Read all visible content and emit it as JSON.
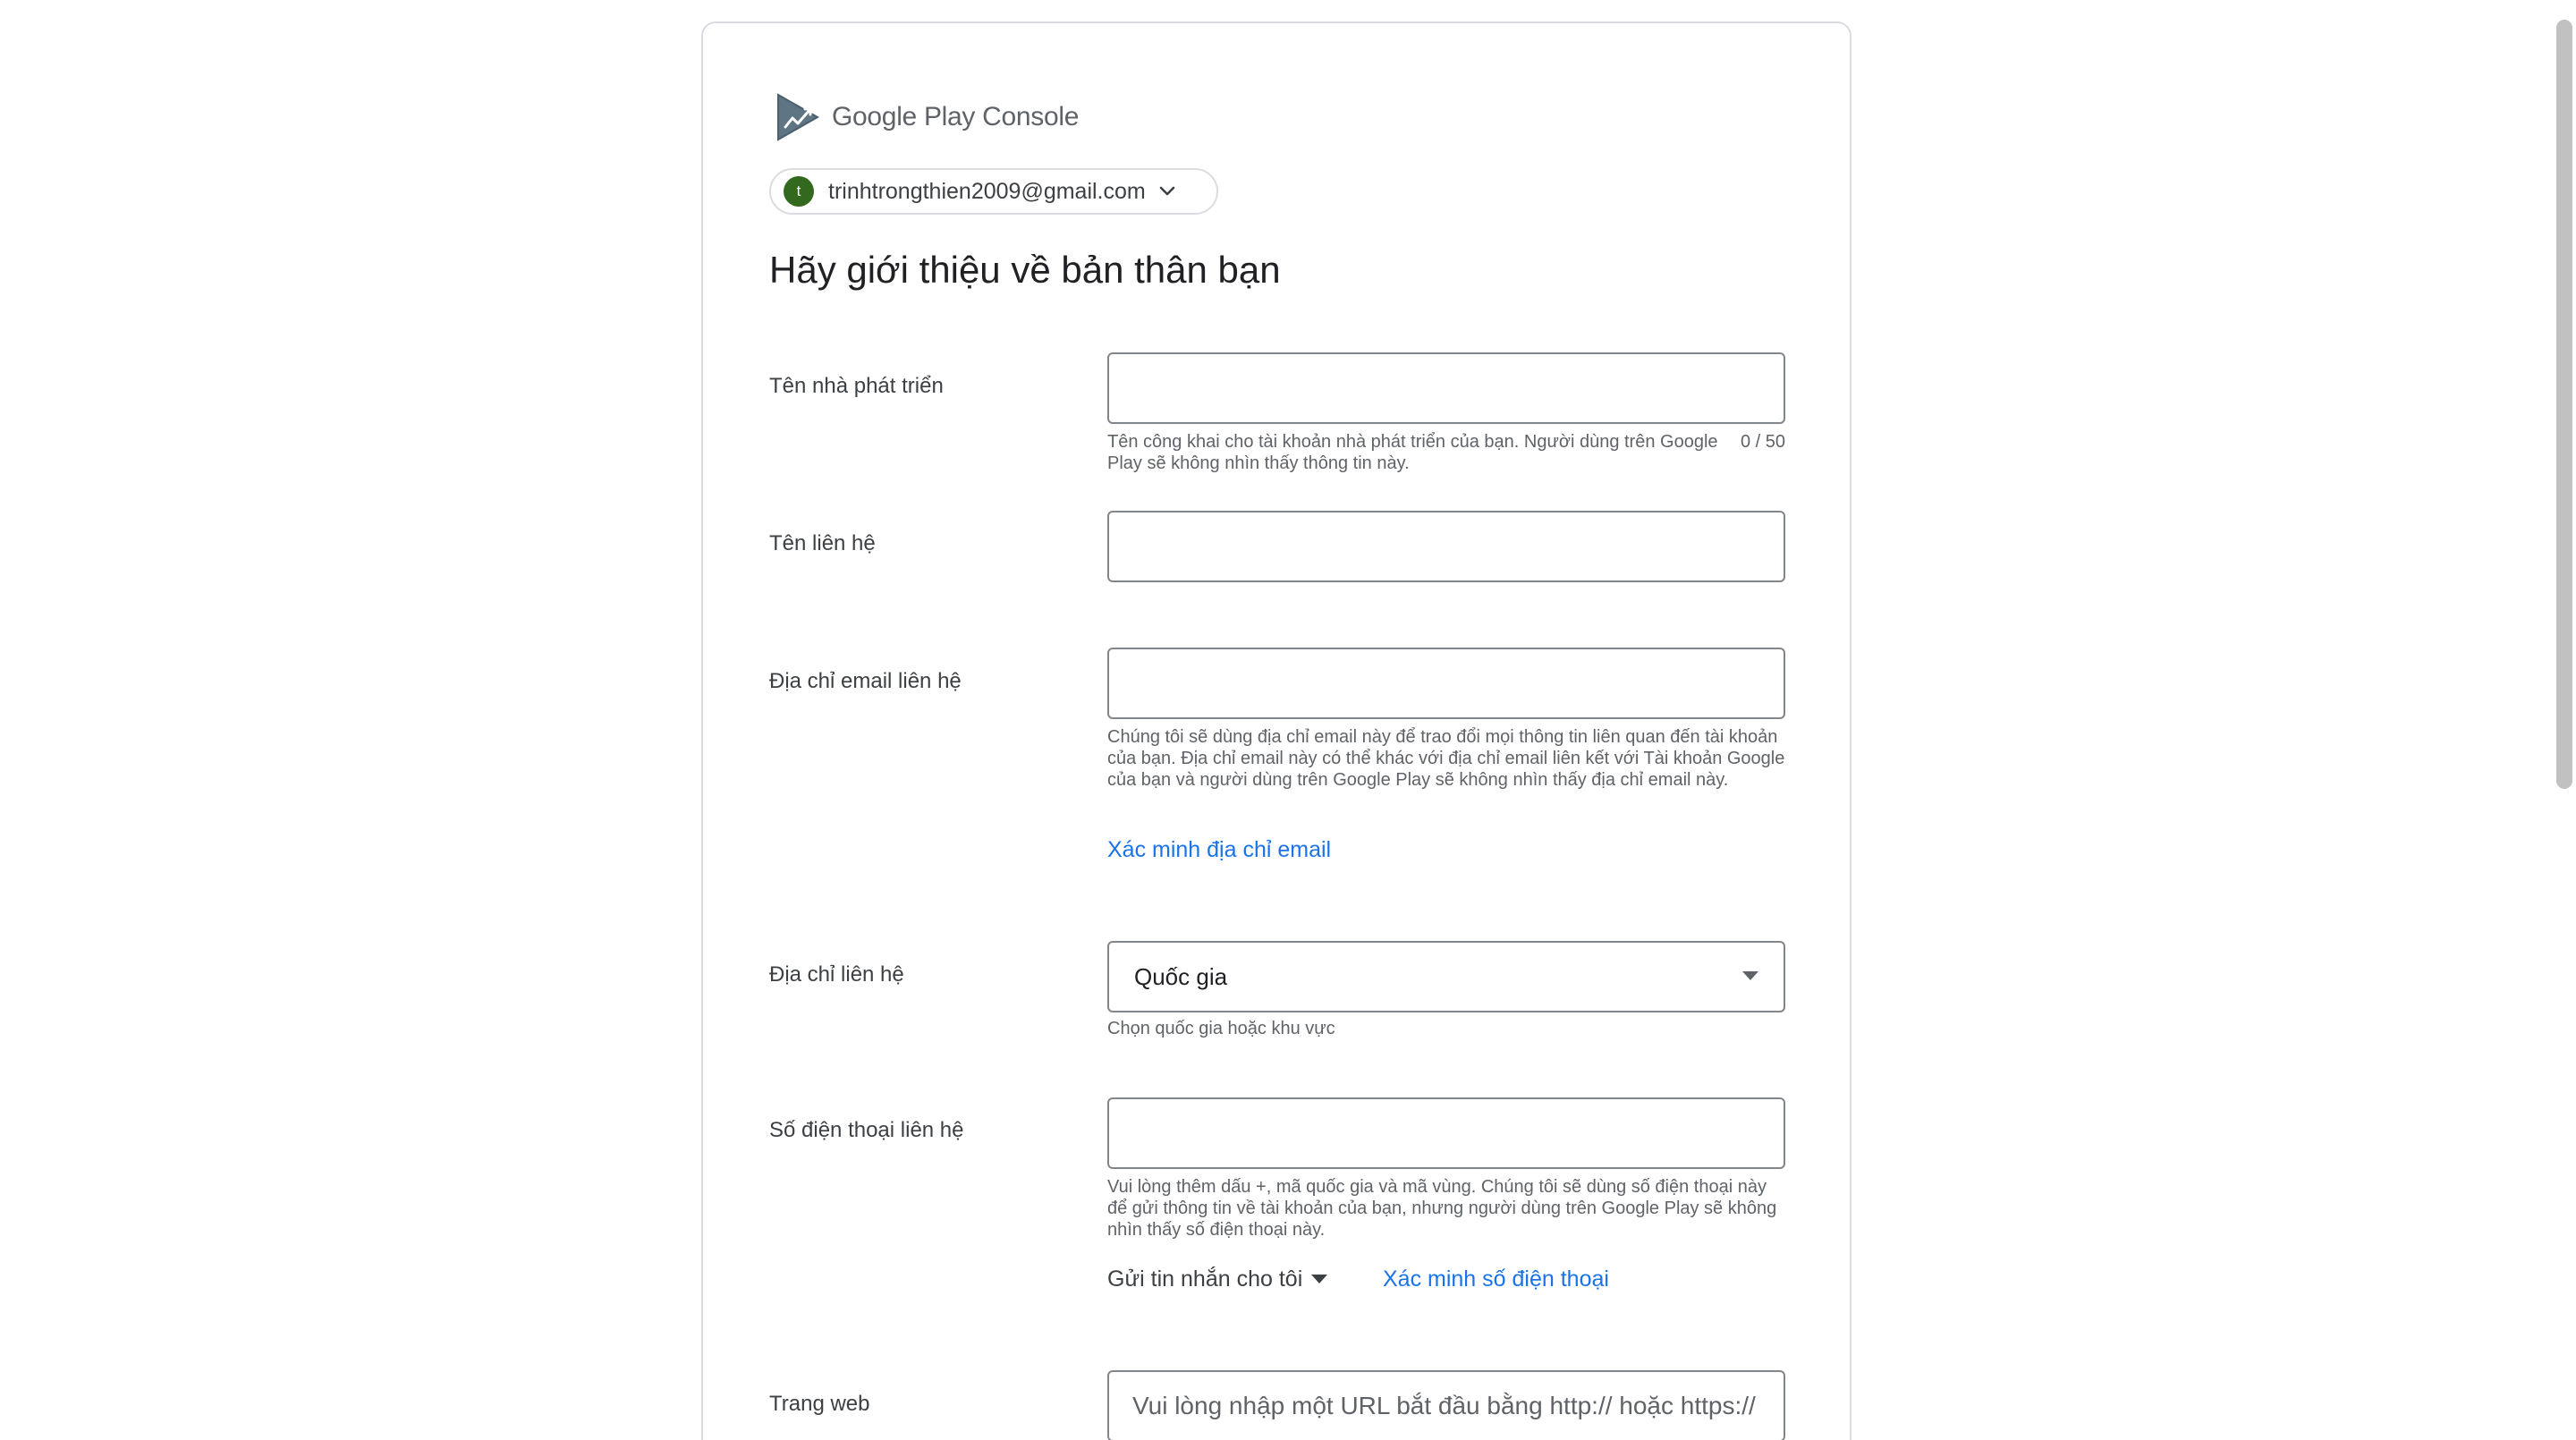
{
  "header": {
    "logo_brand": "Google Play",
    "logo_product": "Console",
    "logo_icon": "play-console-icon"
  },
  "account": {
    "avatar_initial": "t",
    "email": "trinhtrongthien2009@gmail.com",
    "avatar_color": "#33691e"
  },
  "form": {
    "title": "Hãy giới thiệu về bản thân bạn",
    "developer_name": {
      "label": "Tên nhà phát triển",
      "value": "",
      "helper": "Tên công khai cho tài khoản nhà phát triển của bạn. Người dùng trên Google Play sẽ không nhìn thấy thông tin này.",
      "counter": "0 / 50"
    },
    "contact_name": {
      "label": "Tên liên hệ",
      "value": ""
    },
    "contact_email": {
      "label": "Địa chỉ email liên hệ",
      "value": "",
      "helper": "Chúng tôi sẽ dùng địa chỉ email này để trao đổi mọi thông tin liên quan đến tài khoản của bạn. Địa chỉ email này có thể khác với địa chỉ email liên kết với Tài khoản Google của bạn và người dùng trên Google Play sẽ không nhìn thấy địa chỉ email này.",
      "verify_link": "Xác minh địa chỉ email"
    },
    "contact_address": {
      "label": "Địa chỉ liên hệ",
      "country_selected": "Quốc gia",
      "helper": "Chọn quốc gia hoặc khu vực"
    },
    "contact_phone": {
      "label": "Số điện thoại liên hệ",
      "value": "",
      "helper": "Vui lòng thêm dấu +, mã quốc gia và mã vùng. Chúng tôi sẽ dùng số điện thoại này để gửi thông tin về tài khoản của bạn, nhưng người dùng trên Google Play sẽ không nhìn thấy số điện thoại này.",
      "send_method": "Gửi tin nhắn cho tôi",
      "verify_link": "Xác minh số điện thoại"
    },
    "website": {
      "label": "Trang web",
      "placeholder": "Vui lòng nhập một URL bắt đầu bằng http:// hoặc https://"
    }
  },
  "colors": {
    "link": "#1a73e8",
    "border": "#80868b",
    "card_border": "#dadce0"
  }
}
